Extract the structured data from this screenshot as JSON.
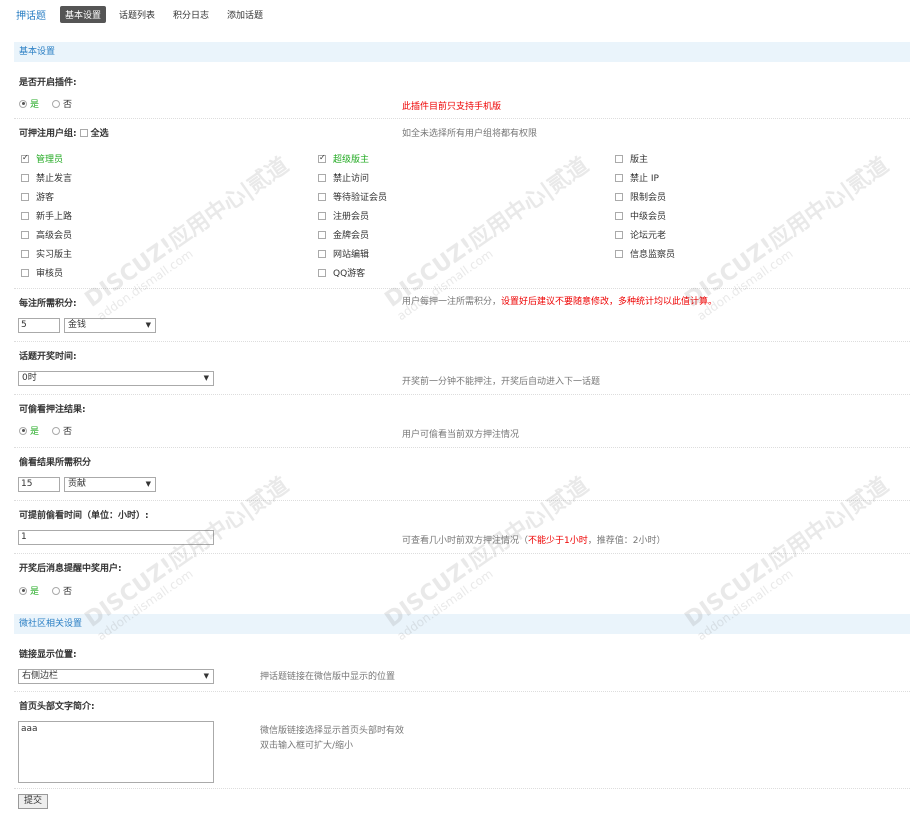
{
  "nav": {
    "brand": "押话题",
    "tabs": [
      "基本设置",
      "话题列表",
      "积分日志",
      "添加话题"
    ]
  },
  "watermark": {
    "main": "DISCUZ!应用中心|贰道",
    "sub": "addon.dismall.com"
  },
  "sections": {
    "basic": "基本设置",
    "wsq": "微社区相关设置"
  },
  "radio": {
    "yes": "是",
    "no": "否"
  },
  "enable": {
    "label": "是否开启插件:",
    "tip": "此插件目前只支持手机版"
  },
  "groups": {
    "label": "可押注用户组:",
    "select_all": "全选",
    "tip": "如全未选择所有用户组将都有权限",
    "items": [
      {
        "name": "管理员",
        "checked": true,
        "green": true
      },
      {
        "name": "超级版主",
        "checked": true,
        "green": true
      },
      {
        "name": "版主",
        "checked": false,
        "green": false
      },
      {
        "name": "禁止发言",
        "checked": false,
        "green": false
      },
      {
        "name": "禁止访问",
        "checked": false,
        "green": false
      },
      {
        "name": "禁止 IP",
        "checked": false,
        "green": false
      },
      {
        "name": "游客",
        "checked": false,
        "green": false
      },
      {
        "name": "等待验证会员",
        "checked": false,
        "green": false
      },
      {
        "name": "限制会员",
        "checked": false,
        "green": false
      },
      {
        "name": "新手上路",
        "checked": false,
        "green": false
      },
      {
        "name": "注册会员",
        "checked": false,
        "green": false
      },
      {
        "name": "中级会员",
        "checked": false,
        "green": false
      },
      {
        "name": "高级会员",
        "checked": false,
        "green": false
      },
      {
        "name": "金牌会员",
        "checked": false,
        "green": false
      },
      {
        "name": "论坛元老",
        "checked": false,
        "green": false
      },
      {
        "name": "实习版主",
        "checked": false,
        "green": false
      },
      {
        "name": "网站编辑",
        "checked": false,
        "green": false
      },
      {
        "name": "信息监察员",
        "checked": false,
        "green": false
      },
      {
        "name": "审核员",
        "checked": false,
        "green": false
      },
      {
        "name": "QQ游客",
        "checked": false,
        "green": false
      }
    ]
  },
  "bet_points": {
    "label": "每注所需积分:",
    "value": "5",
    "currency": "金钱",
    "tip_plain": "用户每押一注所需积分，",
    "tip_red": "设置好后建议不要随意修改，多种统计均以此值计算。"
  },
  "draw_time": {
    "label": "话题开奖时间:",
    "value": "0时",
    "tip": "开奖前一分钟不能押注，开奖后自动进入下一话题"
  },
  "peek": {
    "label": "可偷看押注结果:",
    "tip": "用户可偷看当前双方押注情况"
  },
  "peek_points": {
    "label": "偷看结果所需积分",
    "value": "15",
    "currency": "贡献"
  },
  "peek_time": {
    "label": "可提前偷看时间（单位：小时）:",
    "value": "1",
    "tip_a": "可查看几小时前双方押注情况（",
    "tip_red": "不能少于1小时",
    "tip_b": "，推荐值：2小时）"
  },
  "notify": {
    "label": "开奖后消息提醒中奖用户:"
  },
  "link_pos": {
    "label": "链接显示位置:",
    "value": "右侧边栏",
    "tip": "押话题链接在微信版中显示的位置"
  },
  "home_header": {
    "label": "首页头部文字简介:",
    "value": "aaa",
    "tip1": "微信版链接选择显示首页头部时有效",
    "tip2": "双击输入框可扩大/缩小"
  },
  "submit": "提交"
}
